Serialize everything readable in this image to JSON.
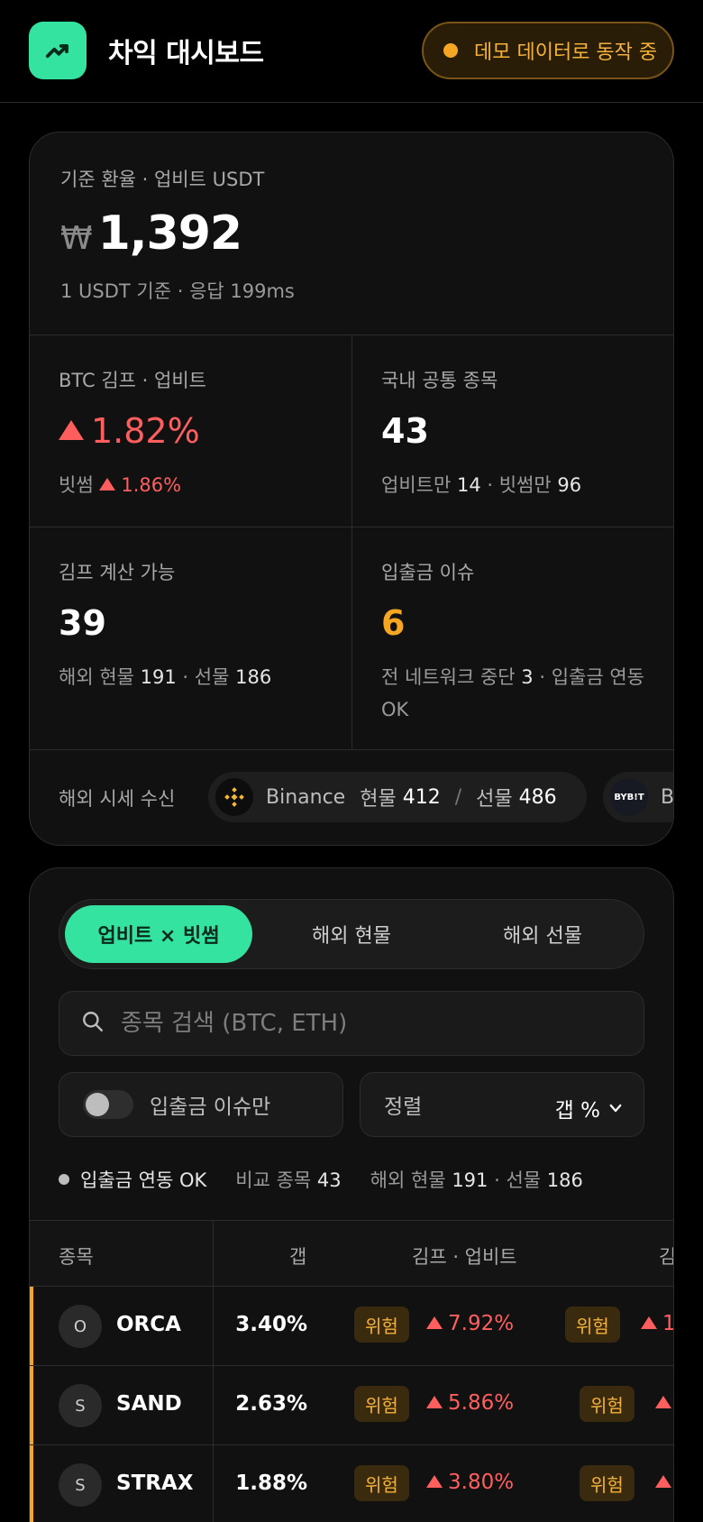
{
  "header": {
    "title": "차익 대시보드",
    "demo_badge": "데모 데이터로 동작 중"
  },
  "summary": {
    "rate_label": "기준 환율 · 업비트 USDT",
    "rate_currency": "₩",
    "rate_value": "1,392",
    "rate_sub": "1 USDT 기준 · 응답 199ms",
    "btc_kimp": {
      "label": "BTC 김프 · 업비트",
      "value": "1.82%",
      "sub_prefix": "빗썸",
      "sub_value": "1.86%"
    },
    "common": {
      "label": "국내 공통 종목",
      "value": "43",
      "upbit_only_label": "업비트만",
      "upbit_only": "14",
      "bithumb_only_label": "빗썸만",
      "bithumb_only": "96"
    },
    "calc": {
      "label": "김프 계산 가능",
      "value": "39",
      "spot_label": "해외 현물",
      "spot": "191",
      "fut_label": "선물",
      "fut": "186"
    },
    "issues": {
      "label": "입출금 이슈",
      "value": "6",
      "net_label": "전 네트워크 중단",
      "net_value": "3",
      "link_label": "입출금 연동 OK"
    },
    "feed": {
      "label": "해외 시세 수신",
      "exchanges": [
        {
          "name": "Binance",
          "spot_label": "현물",
          "spot": "412",
          "fut_label": "선물",
          "fut": "486",
          "icon": "binance-icon"
        },
        {
          "name": "B",
          "icon": "bybit-icon",
          "icon_text": "BYB!T"
        }
      ]
    }
  },
  "main": {
    "tabs": [
      {
        "label": "업비트 × 빗썸",
        "active": true
      },
      {
        "label": "해외 현물",
        "active": false
      },
      {
        "label": "해외 선물",
        "active": false
      }
    ],
    "search_placeholder": "종목 검색 (BTC, ETH)",
    "issue_toggle_label": "입출금 이슈만",
    "sort_label": "정렬",
    "sort_value": "갭 %",
    "status": {
      "link": "입출금 연동 OK",
      "compare_label": "비교 종목",
      "compare": "43",
      "spot_label": "해외 현물",
      "spot": "191",
      "fut_label": "선물",
      "fut": "186"
    },
    "columns": [
      "종목",
      "갭",
      "김프 · 업비트",
      "김"
    ],
    "rows": [
      {
        "icon": "O",
        "symbol": "ORCA",
        "gap": "3.40%",
        "risk": "위험",
        "kimp_upbit": "7.92%",
        "risk2": "위험",
        "kimp2": "1"
      },
      {
        "icon": "S",
        "symbol": "SAND",
        "gap": "2.63%",
        "risk": "위험",
        "kimp_upbit": "5.86%",
        "risk2": "위험",
        "kimp2": ""
      },
      {
        "icon": "S",
        "symbol": "STRAX",
        "gap": "1.88%",
        "risk": "위험",
        "kimp_upbit": "3.80%",
        "risk2": "위험",
        "kimp2": ""
      }
    ]
  },
  "colors": {
    "accent": "#34e3a0",
    "up": "#ff5e5e",
    "warning": "#f5a623"
  }
}
